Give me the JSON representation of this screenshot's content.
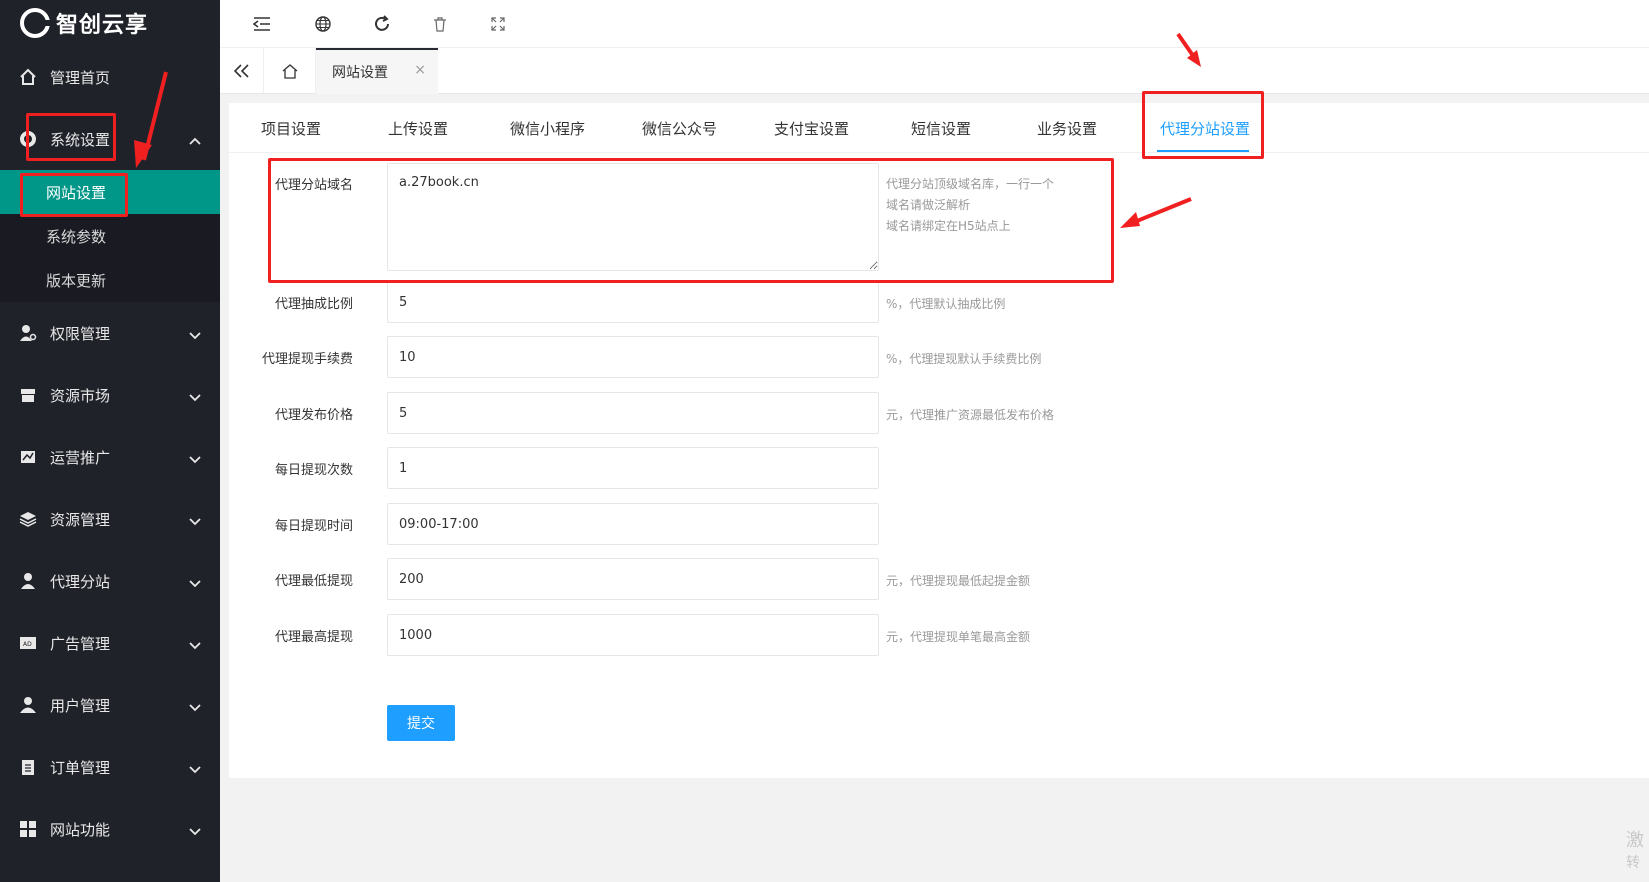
{
  "app": {
    "logo_text": "智创云享"
  },
  "sidebar": {
    "items": [
      {
        "label": "管理首页",
        "icon": "home-icon"
      },
      {
        "label": "系统设置",
        "icon": "gear-icon",
        "expanded": true
      },
      {
        "label": "权限管理",
        "icon": "users-key-icon"
      },
      {
        "label": "资源市场",
        "icon": "store-icon"
      },
      {
        "label": "运营推广",
        "icon": "chart-icon"
      },
      {
        "label": "资源管理",
        "icon": "layers-icon"
      },
      {
        "label": "代理分站",
        "icon": "agent-icon"
      },
      {
        "label": "广告管理",
        "icon": "ad-icon"
      },
      {
        "label": "用户管理",
        "icon": "user-icon"
      },
      {
        "label": "订单管理",
        "icon": "clipboard-icon"
      },
      {
        "label": "网站功能",
        "icon": "grid-icon"
      }
    ],
    "sub_items": [
      {
        "label": "网站设置",
        "active": true
      },
      {
        "label": "系统参数"
      },
      {
        "label": "版本更新"
      }
    ]
  },
  "page_tab": {
    "label": "网站设置",
    "close": "×"
  },
  "settings_tabs": [
    "项目设置",
    "上传设置",
    "微信小程序",
    "微信公众号",
    "支付宝设置",
    "短信设置",
    "业务设置",
    "代理分站设置"
  ],
  "form": {
    "domain": {
      "label": "代理分站域名",
      "value": "a.27book.cn",
      "hint_lines": [
        "代理分站顶级域名库，一行一个",
        "域名请做泛解析",
        "域名请绑定在H5站点上"
      ]
    },
    "fields": [
      {
        "label": "代理抽成比例",
        "value": "5",
        "hint": "%，代理默认抽成比例"
      },
      {
        "label": "代理提现手续费",
        "value": "10",
        "hint": "%，代理提现默认手续费比例"
      },
      {
        "label": "代理发布价格",
        "value": "5",
        "hint": "元，代理推广资源最低发布价格"
      },
      {
        "label": "每日提现次数",
        "value": "1",
        "hint": ""
      },
      {
        "label": "每日提现时间",
        "value": "09:00-17:00",
        "hint": ""
      },
      {
        "label": "代理最低提现",
        "value": "200",
        "hint": "元，代理提现最低起提金额"
      },
      {
        "label": "代理最高提现",
        "value": "1000",
        "hint": "元，代理提现单笔最高金额"
      }
    ],
    "submit_label": "提交"
  },
  "watermark": {
    "line1": "激",
    "line2": "转"
  },
  "colors": {
    "accent": "#1e9fff",
    "sidebar_active": "#009688",
    "annotation": "#f02020"
  }
}
